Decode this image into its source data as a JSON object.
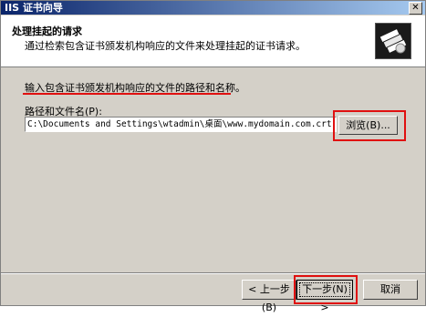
{
  "window": {
    "title": "IIS 证书向导",
    "close_icon": "close-icon"
  },
  "header": {
    "title": "处理挂起的请求",
    "description": "通过检索包含证书颁发机构响应的文件来处理挂起的证书请求。",
    "icon": "certificate-wizard-icon"
  },
  "content": {
    "prompt": "输入包含证书颁发机构响应的文件的路径和名称。",
    "field_label": "路径和文件名(P):",
    "path_value": "C:\\Documents and Settings\\wtadmin\\桌面\\www.mydomain.com.crt",
    "browse_label": "浏览(B)..."
  },
  "footer": {
    "back_label": "< 上一步(B)",
    "next_label": "下一步(N) >",
    "cancel_label": "取消"
  },
  "colors": {
    "title_bar": "#0a246a",
    "highlight": "#e01010",
    "dialog_bg": "#d4d0c8"
  }
}
